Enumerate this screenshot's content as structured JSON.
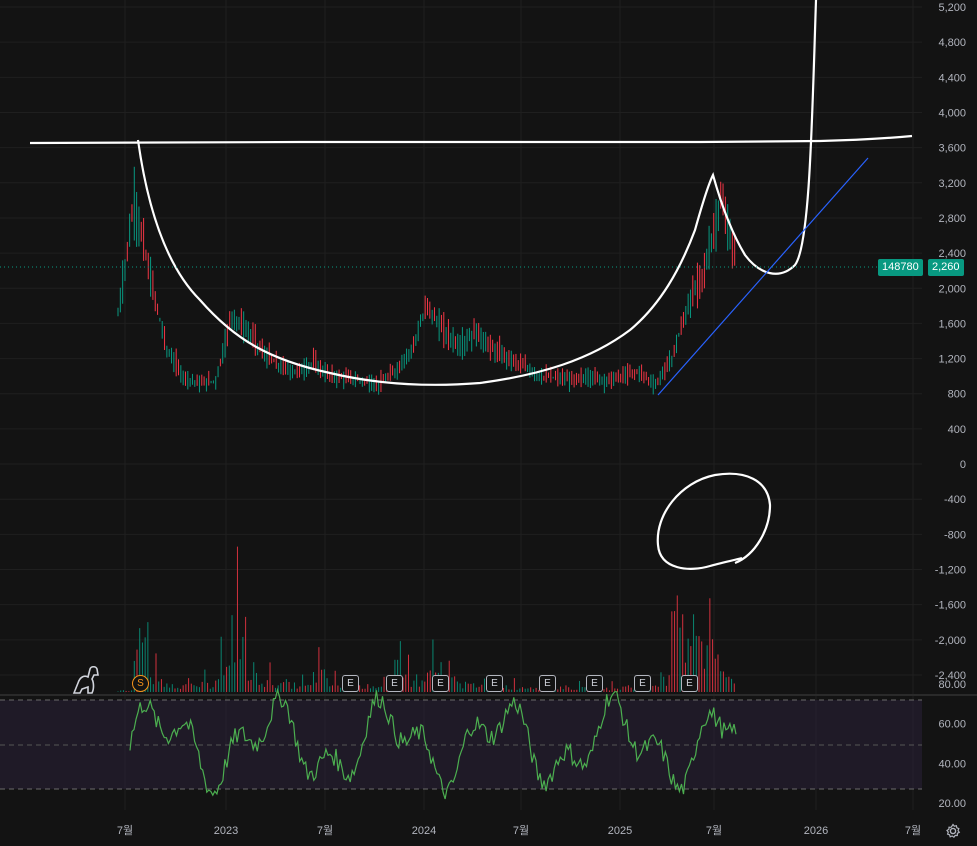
{
  "chart_data": {
    "type": "line",
    "title": "",
    "main_panel": {
      "y_ticks": [
        "5,200",
        "4,800",
        "4,400",
        "4,000",
        "3,600",
        "3,200",
        "2,800",
        "2,400",
        "2,000",
        "1,600",
        "1,200",
        "800",
        "400",
        "0",
        "-400",
        "-800",
        "-1,200",
        "-1,600",
        "-2,000",
        "-2,400"
      ],
      "ylim": [
        -2400,
        5200
      ],
      "price_series": {
        "x": [
          "2022-06",
          "2022-07",
          "2022-08",
          "2022-09",
          "2022-10",
          "2022-11",
          "2022-12",
          "2023-01",
          "2023-02",
          "2023-03",
          "2023-04",
          "2023-05",
          "2023-06",
          "2023-07",
          "2023-08",
          "2023-09",
          "2023-10",
          "2023-11",
          "2023-12",
          "2024-01",
          "2024-02",
          "2024-03",
          "2024-04",
          "2024-05",
          "2024-06",
          "2024-07",
          "2024-08",
          "2024-09",
          "2024-10",
          "2024-11",
          "2024-12",
          "2025-01",
          "2025-02",
          "2025-03",
          "2025-04",
          "2025-05",
          "2025-06",
          "2025-07",
          "2025-08"
        ],
        "close": [
          1700,
          3000,
          2100,
          1300,
          1000,
          920,
          950,
          1700,
          1500,
          1250,
          1100,
          1050,
          1150,
          1000,
          980,
          950,
          900,
          1050,
          1300,
          1800,
          1500,
          1350,
          1500,
          1300,
          1200,
          1100,
          1000,
          980,
          950,
          1000,
          950,
          1000,
          1050,
          900,
          1200,
          1800,
          2200,
          3000,
          2260
        ]
      },
      "last_price_label": "2,260",
      "volume_label": "148780",
      "volume_series": [
        50,
        2300,
        500,
        300,
        250,
        300,
        900,
        2400,
        600,
        400,
        300,
        250,
        700,
        300,
        200,
        250,
        200,
        1200,
        400,
        900,
        500,
        300,
        400,
        250,
        200,
        200,
        150,
        200,
        150,
        200,
        150,
        200,
        300,
        500,
        2500,
        2800,
        1800,
        700
      ]
    },
    "rsi_panel": {
      "y_ticks": [
        "80.00",
        "60.00",
        "40.00",
        "20.00"
      ],
      "ylim": [
        20,
        85
      ],
      "band": [
        30,
        70
      ],
      "midline": 50
    },
    "x_ticks": [
      "7월",
      "2023",
      "7월",
      "2024",
      "7월",
      "2025",
      "7월",
      "2026",
      "7월"
    ],
    "grid": true
  },
  "markers": {
    "split": "S",
    "earnings": [
      "E",
      "E",
      "E",
      "E",
      "E",
      "E",
      "E",
      "E"
    ]
  },
  "icons": {
    "settings": "settings-icon",
    "logo": "dino-logo-icon"
  },
  "colors": {
    "background": "#131313",
    "up": "#089981",
    "down": "#f23645",
    "rsi": "#4caf50",
    "drawing": "#ffffff",
    "trend": "#2962ff",
    "grid": "#232323"
  }
}
